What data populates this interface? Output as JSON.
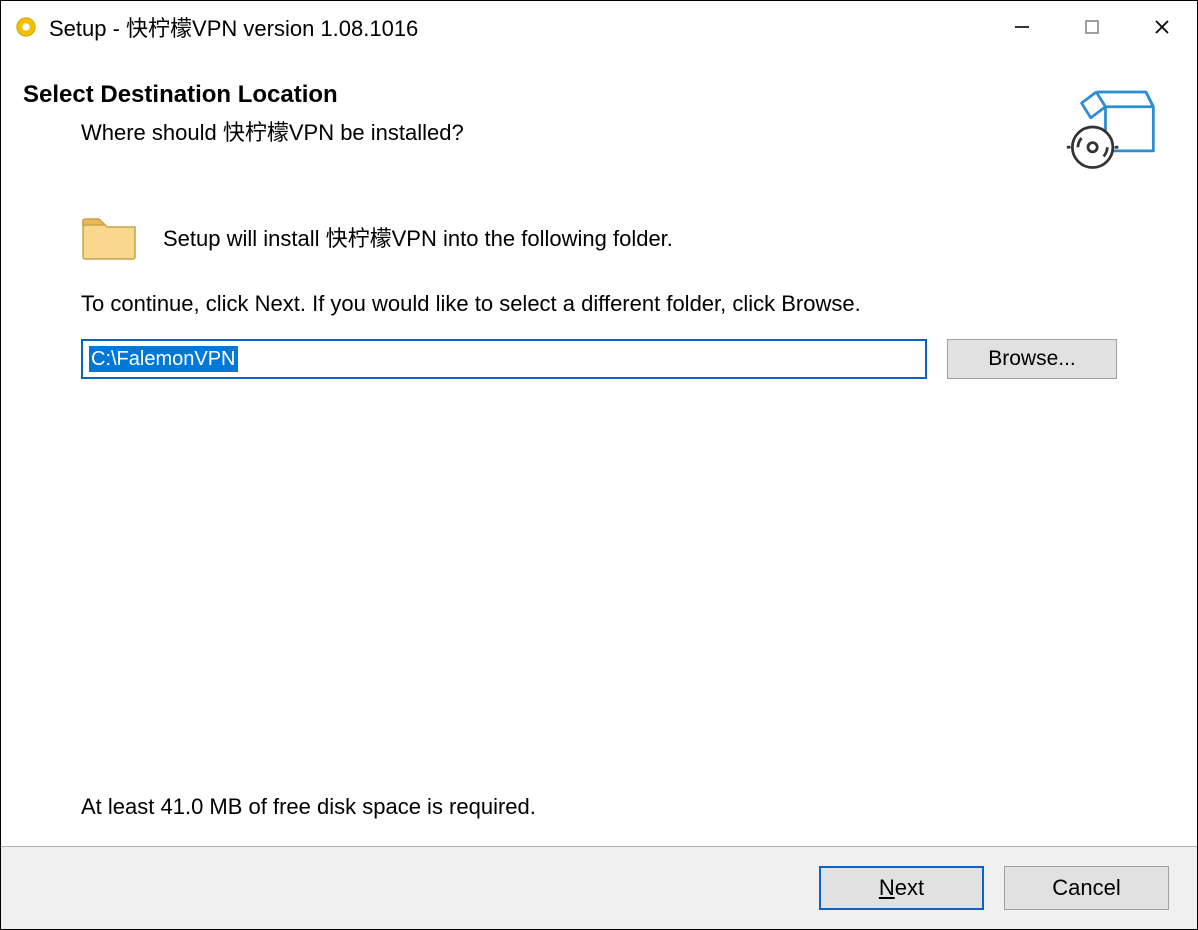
{
  "titlebar": {
    "title": "Setup - 快柠檬VPN version 1.08.1016"
  },
  "header": {
    "heading": "Select Destination Location",
    "subheading": "Where should 快柠檬VPN be installed?"
  },
  "content": {
    "intro": "Setup will install 快柠檬VPN into the following folder.",
    "instruction": "To continue, click Next. If you would like to select a different folder, click Browse.",
    "path_value": "C:\\FalemonVPN",
    "browse_label": "Browse...",
    "disk_requirement": "At least 41.0 MB of free disk space is required."
  },
  "footer": {
    "next_label": "Next",
    "next_mnemonic": "N",
    "cancel_label": "Cancel"
  }
}
